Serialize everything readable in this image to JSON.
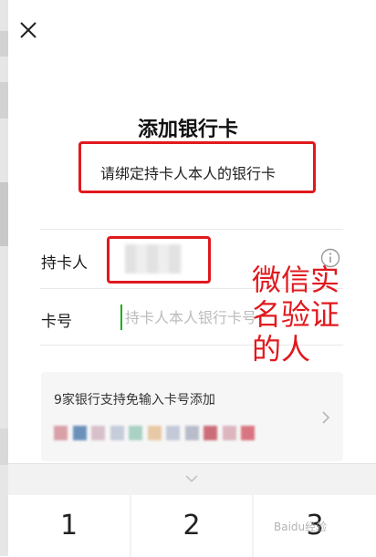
{
  "header": {
    "title": "添加银行卡",
    "subtitle": "请绑定持卡人本人的银行卡"
  },
  "form": {
    "holder_label": "持卡人",
    "card_label": "卡号",
    "card_placeholder": "持卡人本人银行卡号"
  },
  "annotation": {
    "text": "微信实名验证的人"
  },
  "banks": {
    "text": "9家银行支持免输入卡号添加",
    "logo_colors": [
      "#d9a0a8",
      "#6b91bb",
      "#d8c0ca",
      "#c5ccda",
      "#a9d1c4",
      "#e8c9a6",
      "#c3c9d8",
      "#b8bccb",
      "#cc6e7a",
      "#dcb5bf",
      "#d97580"
    ]
  },
  "keypad": {
    "keys": [
      "1",
      "2",
      "3"
    ]
  },
  "watermark": {
    "text": "Baidu经验"
  },
  "colors": {
    "annotation_red": "#e0191e",
    "cursor_green": "#1aad19"
  }
}
